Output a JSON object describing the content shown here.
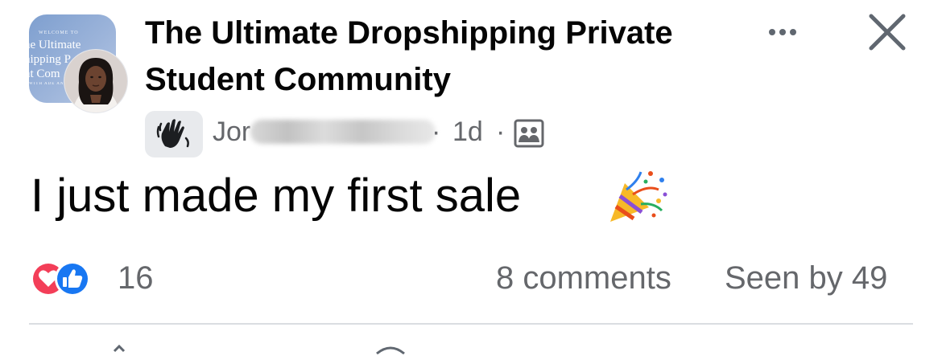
{
  "group": {
    "name": "The Ultimate Dropshipping Private Student Community",
    "avatar_lines": [
      "WELCOME TO",
      "he Ultimate",
      "hipping P",
      "nt Com",
      "WITH ADE AND"
    ]
  },
  "post": {
    "author_visible": "Jor",
    "time": "1d",
    "separator": "·",
    "text": "I just made my first sale",
    "badge_icon": "waving-hand-icon",
    "audience_icon": "group-members-icon",
    "emoji_icon": "party-popper-icon"
  },
  "stats": {
    "reactions_count": "16",
    "comments": "8 comments",
    "seen_by": "Seen by 49",
    "reaction_icons": [
      "heart-reaction-icon",
      "like-reaction-icon"
    ]
  },
  "colors": {
    "text_primary": "#050505",
    "text_secondary": "#65676b",
    "like_blue": "#1877f2",
    "love_red": "#f33e58",
    "divider": "#dadde1"
  }
}
